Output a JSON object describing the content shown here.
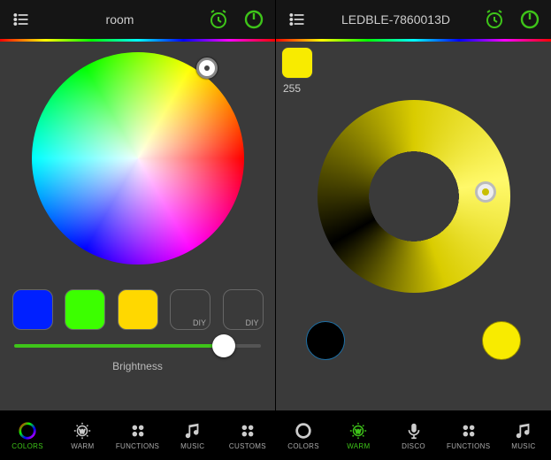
{
  "left": {
    "title": "room",
    "swatches": [
      {
        "label": "",
        "bg": "#0020ff"
      },
      {
        "label": "",
        "bg": "#3cff00"
      },
      {
        "label": "",
        "bg": "#ffd800"
      },
      {
        "label": "DIY",
        "bg": "#3a3a3a"
      },
      {
        "label": "DIY",
        "bg": "#3a3a3a"
      }
    ],
    "brightness_label": "Brightness",
    "tabs": [
      {
        "label": "COLORS",
        "icon": "colors-icon",
        "active": true
      },
      {
        "label": "WARM",
        "icon": "warm-icon",
        "active": false
      },
      {
        "label": "FUNCTIONS",
        "icon": "functions-icon",
        "active": false
      },
      {
        "label": "MUSIC",
        "icon": "music-icon",
        "active": false
      },
      {
        "label": "CUSTOMS",
        "icon": "customs-icon",
        "active": false
      }
    ]
  },
  "right": {
    "title": "LEDBLE-7860013D",
    "value": "255",
    "tabs": [
      {
        "label": "COLORS",
        "icon": "colors-ring-icon",
        "active": false
      },
      {
        "label": "WARM",
        "icon": "warm-icon",
        "active": true
      },
      {
        "label": "DISCO",
        "icon": "mic-icon",
        "active": false
      },
      {
        "label": "FUNCTIONS",
        "icon": "functions-icon",
        "active": false
      },
      {
        "label": "MUSIC",
        "icon": "music-icon",
        "active": false
      }
    ]
  },
  "icons": {
    "menu": "menu-list-icon",
    "alarm": "alarm-icon",
    "power": "power-icon"
  }
}
